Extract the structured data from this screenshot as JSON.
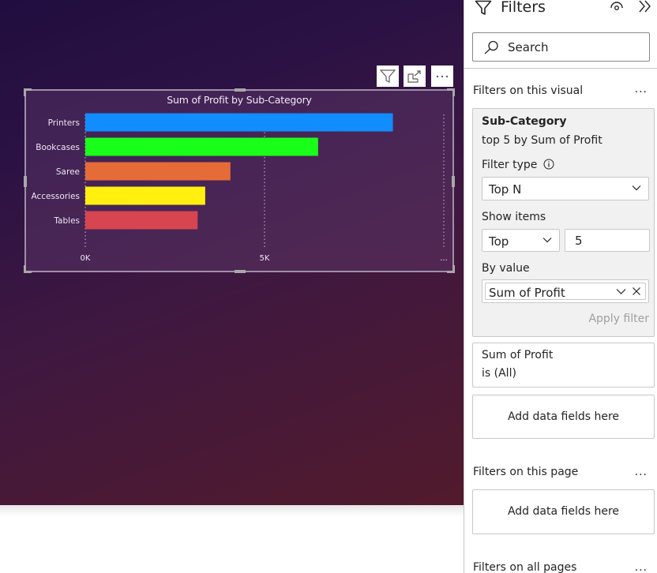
{
  "visual_header": {
    "filter_icon": "filter-icon",
    "focus_icon": "focus-mode-icon",
    "more_icon": "more-options-icon"
  },
  "chart_data": {
    "type": "bar",
    "orientation": "horizontal",
    "title": "Sum of Profit by Sub-Category",
    "categories": [
      "Printers",
      "Bookcases",
      "Saree",
      "Accessories",
      "Tables"
    ],
    "values": [
      8580,
      6494,
      4048,
      3345,
      3134
    ],
    "colors": [
      "#118dff",
      "#1aff1a",
      "#e66c37",
      "#fff00f",
      "#d64550"
    ],
    "xlabel": "",
    "ylabel": "",
    "xlim": [
      0,
      10000
    ],
    "x_ticks": [
      {
        "value": 0,
        "label": "0K"
      },
      {
        "value": 5000,
        "label": "5K"
      },
      {
        "value": 10000,
        "label": "..."
      }
    ],
    "grid": true,
    "legend": "none"
  },
  "filters_pane": {
    "title": "Filters",
    "search_placeholder": "Search",
    "visual_section": {
      "heading": "Filters on this visual",
      "more": "...",
      "active_filter": {
        "field": "Sub-Category",
        "summary": "top 5 by Sum of Profit",
        "filter_type_label": "Filter type",
        "filter_type_value": "Top N",
        "show_items_label": "Show items",
        "show_items_direction": "Top",
        "show_items_count": "5",
        "by_value_label": "By value",
        "by_value_field": "Sum of Profit",
        "apply_label": "Apply filter"
      },
      "other_filter": {
        "field": "Sum of Profit",
        "summary": "is (All)"
      },
      "add_fields": "Add data fields here"
    },
    "page_section": {
      "heading": "Filters on this page",
      "more": "...",
      "add_fields": "Add data fields here"
    },
    "all_pages_section": {
      "heading": "Filters on all pages",
      "more": "..."
    }
  }
}
